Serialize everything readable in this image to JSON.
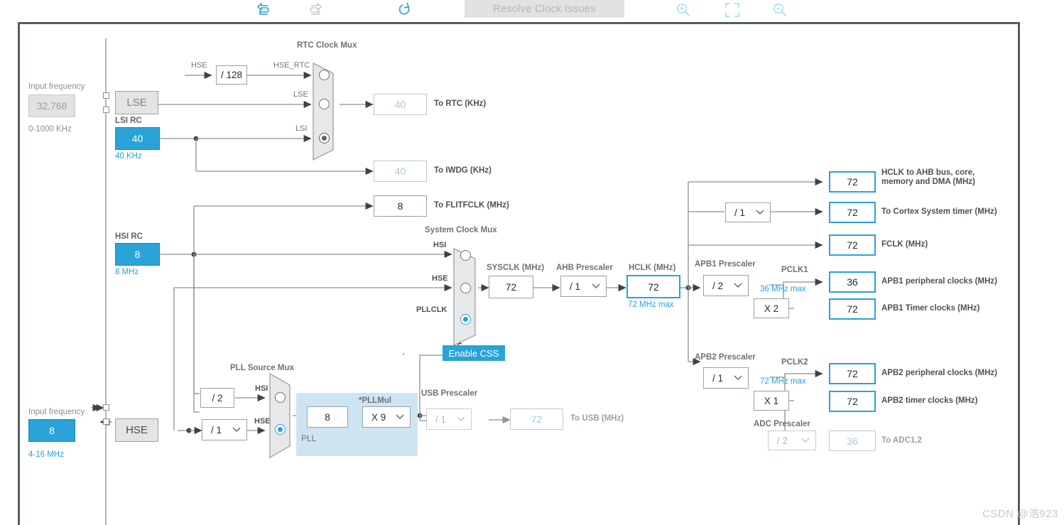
{
  "toolbar": {
    "undo_icon": "undo-arrow-icon",
    "redo_icon": "redo-arrow-icon",
    "reset_icon": "reset-circular-arrow-icon",
    "resolve_label": "Resolve Clock Issues",
    "zoom_in_icon": "zoom-in-magnifier-icon",
    "fit_icon": "fit-to-screen-icon",
    "zoom_out_icon": "zoom-out-magnifier-icon"
  },
  "lse": {
    "input_frequency_label": "Input frequency",
    "value": "32.768",
    "range": "0-1000 KHz",
    "block_label": "LSE"
  },
  "lsi": {
    "title": "LSI RC",
    "value": "40",
    "note": "40 KHz"
  },
  "hse_rtc_div": {
    "input_label": "HSE",
    "value": "/ 128",
    "output_label": "HSE_RTC"
  },
  "rtc_mux": {
    "title": "RTC Clock Mux",
    "inputs": [
      "HSE_RTC",
      "LSE",
      "LSI"
    ],
    "selected": 2
  },
  "outputs_left": {
    "rtc": {
      "value": "40",
      "label": "To RTC (KHz)"
    },
    "iwdg": {
      "value": "40",
      "label": "To IWDG (KHz)"
    },
    "flitfclk": {
      "value": "8",
      "label": "To FLITFCLK (MHz)"
    }
  },
  "hsi": {
    "title": "HSI RC",
    "value": "8",
    "note": "8 MHz"
  },
  "hse": {
    "input_frequency_label": "Input frequency",
    "value": "8",
    "range": "4-16 MHz",
    "block_label": "HSE",
    "prescaler": "/ 1"
  },
  "pll_source_mux": {
    "title": "PLL Source Mux",
    "hsi_div": "/ 2",
    "inputs": [
      "HSI",
      "HSE"
    ],
    "selected": 1
  },
  "pll": {
    "area_label": "PLL",
    "input_value": "8",
    "mul_label": "*PLLMul",
    "mul_value": "X 9"
  },
  "system_clock_mux": {
    "title": "System Clock Mux",
    "inputs": [
      "HSI",
      "HSE",
      "PLLCLK"
    ],
    "selected": 2,
    "css_label": "Enable CSS"
  },
  "sysclk": {
    "label": "SYSCLK (MHz)",
    "value": "72"
  },
  "ahb_prescaler": {
    "label": "AHB Prescaler",
    "value": "/ 1"
  },
  "hclk": {
    "label": "HCLK (MHz)",
    "value": "72",
    "note": "72 MHz max"
  },
  "usb": {
    "prescaler_label": "USB Prescaler",
    "prescaler_value": "/ 1",
    "value": "72",
    "label": "To USB (MHz)"
  },
  "ahb_outputs": [
    {
      "value": "72",
      "label_line1": "HCLK to AHB bus, core,",
      "label_line2": "memory and DMA (MHz)"
    },
    {
      "value": "72",
      "label_line1": "To Cortex System timer (MHz)",
      "label_line2": "",
      "prescaler": "/ 1"
    },
    {
      "value": "72",
      "label_line1": "FCLK (MHz)",
      "label_line2": ""
    }
  ],
  "apb1": {
    "prescaler_label": "APB1 Prescaler",
    "prescaler_value": "/ 2",
    "pclk_label": "PCLK1",
    "max_note": "36 MHz max",
    "peripheral": {
      "value": "36",
      "label": "APB1 peripheral clocks (MHz)"
    },
    "multiplier": "X 2",
    "timer": {
      "value": "72",
      "label": "APB1 Timer clocks (MHz)"
    }
  },
  "apb2": {
    "prescaler_label": "APB2 Prescaler",
    "prescaler_value": "/ 1",
    "pclk_label": "PCLK2",
    "max_note": "72 MHz max",
    "peripheral": {
      "value": "72",
      "label": "APB2 peripheral clocks (MHz)"
    },
    "multiplier": "X 1",
    "timer": {
      "value": "72",
      "label": "APB2 timer clocks (MHz)"
    },
    "adc_prescaler_label": "ADC Prescaler",
    "adc_prescaler_value": "/ 2",
    "adc": {
      "value": "36",
      "label": "To ADC1,2"
    }
  },
  "watermark": "CSDN @浩923"
}
